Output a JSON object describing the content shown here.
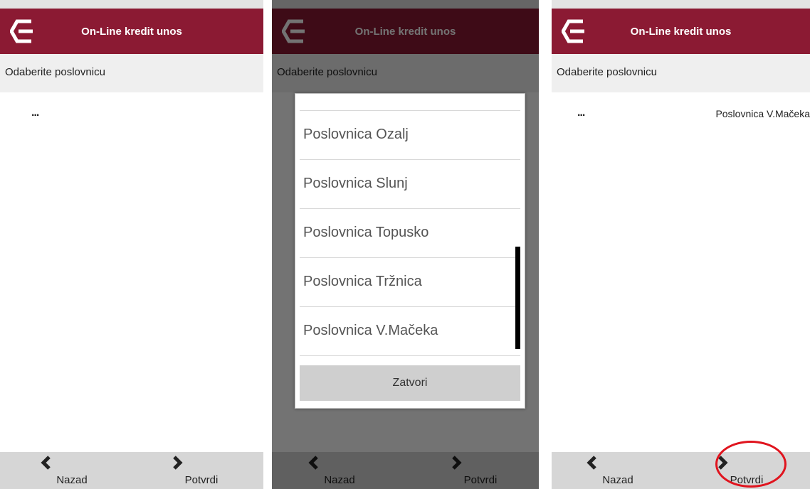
{
  "header_title": "On-Line kredit unos",
  "subheader": "Odaberite poslovnicu",
  "ellipsis": "...",
  "selected_value": "Poslovnica V.Mačeka",
  "dialog": {
    "items": [
      "Poslovnica Ozalj",
      "Poslovnica Slunj",
      "Poslovnica Topusko",
      "Poslovnica Tržnica",
      "Poslovnica V.Mačeka"
    ],
    "close_label": "Zatvori"
  },
  "footer": {
    "back_label": "Nazad",
    "confirm_label": "Potvrdi"
  },
  "colors": {
    "brand": "#8b1a33",
    "highlight": "#e0141e"
  },
  "icons": {
    "logo": "bank-logo-icon",
    "back": "chevron-left-icon",
    "forward": "chevron-right-icon"
  }
}
